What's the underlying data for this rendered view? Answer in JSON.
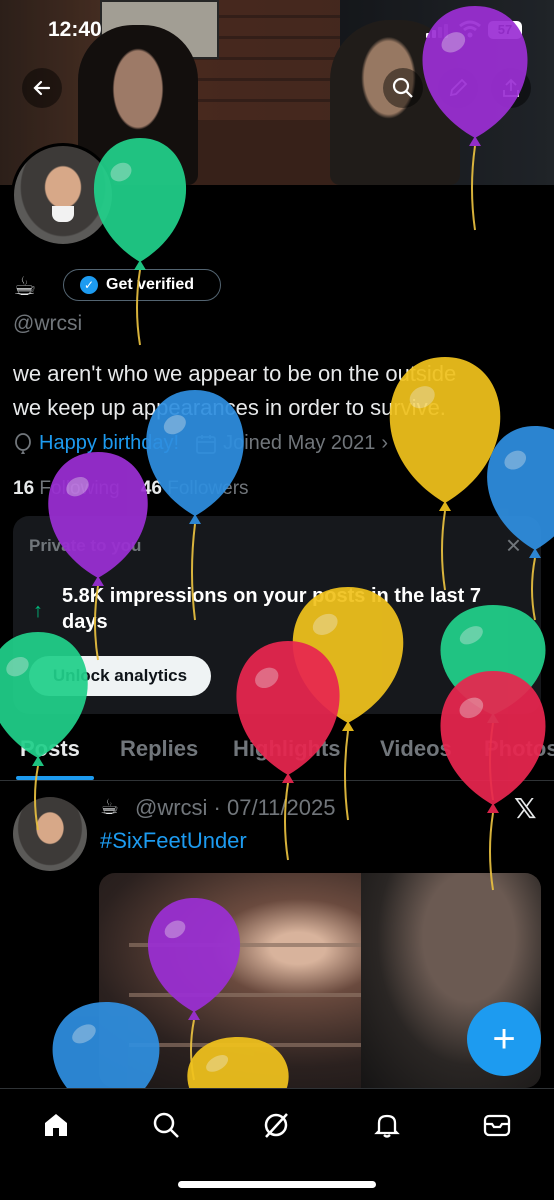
{
  "status_bar": {
    "time": "12:40",
    "battery": "57"
  },
  "icons": {
    "back": "arrow-left-icon",
    "search": "search-icon",
    "edit": "pencil-icon",
    "share": "share-icon",
    "verified": "verified-check-icon",
    "birthday": "balloon-outline-icon",
    "calendar": "calendar-icon",
    "close": "close-icon",
    "arrow_up": "arrow-up-icon",
    "x_logo": "x-logo-icon"
  },
  "profile": {
    "emoji": "☕",
    "get_verified_label": "Get verified",
    "handle": "@wrcsi",
    "bio_line1": "we aren't who we appear to be on the outside",
    "bio_line2": "we keep up appearances in order to survive.",
    "birthday": "Happy birthday!",
    "joined": "Joined May 2021",
    "following_count": "16",
    "following_label": "Following",
    "followers_count": "46",
    "followers_label": "Followers"
  },
  "private_card": {
    "title": "Private to you",
    "stat": "5.8K impressions on your posts in the last 7 days",
    "button": "Unlock analytics"
  },
  "tabs": [
    "Posts",
    "Replies",
    "Highlights",
    "Videos",
    "Photos"
  ],
  "post": {
    "emoji": "☕",
    "meta": "@wrcsi · 07/11/2025",
    "hashtag": "#SixFeetUnder"
  },
  "fab_label": "+",
  "bottom_nav": [
    "home-icon",
    "search-icon",
    "grok-icon",
    "bell-icon",
    "mail-icon"
  ],
  "balloon_colors": {
    "purple": "#9b2fd4",
    "green": "#21d08a",
    "blue": "#2f8fe0",
    "yellow": "#f0c21d",
    "red": "#e8264f"
  }
}
